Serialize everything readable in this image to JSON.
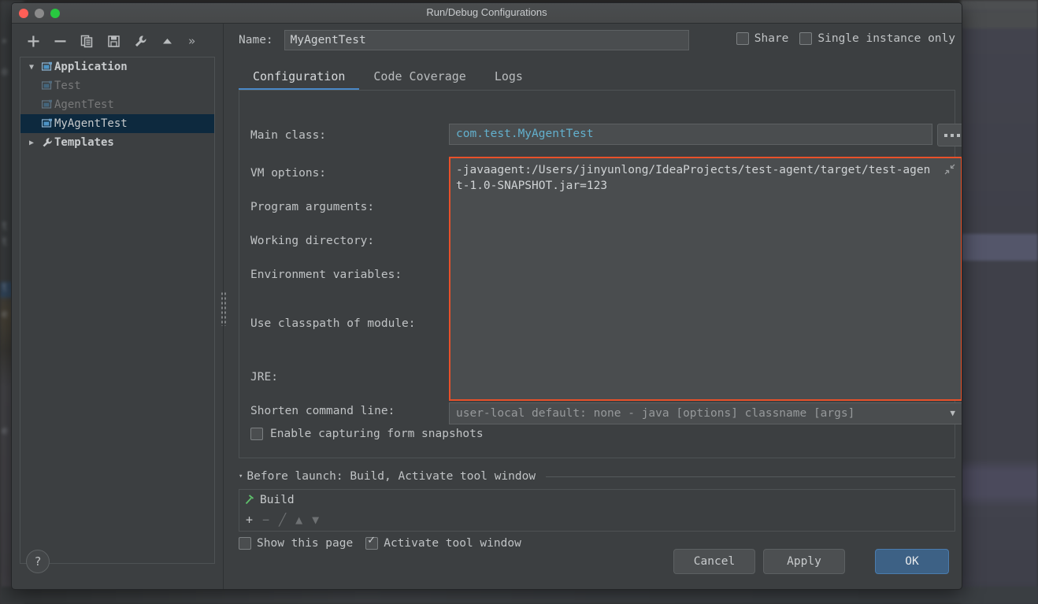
{
  "window": {
    "title": "Run/Debug Configurations",
    "traffic_lights": [
      "close",
      "minimize",
      "zoom"
    ]
  },
  "left_toolbar": {
    "buttons": [
      {
        "name": "add-configuration",
        "icon": "plus-icon"
      },
      {
        "name": "remove-configuration",
        "icon": "minus-icon"
      },
      {
        "name": "copy-configuration",
        "icon": "copy-icon"
      },
      {
        "name": "save-configuration",
        "icon": "save-icon"
      },
      {
        "name": "edit-templates",
        "icon": "wrench-icon"
      },
      {
        "name": "move-up",
        "icon": "triangle-up-icon"
      }
    ],
    "overflow_label": "»"
  },
  "tree": {
    "nodes": [
      {
        "label": "Application",
        "expander": "▼",
        "icon": "application-icon",
        "bold": true,
        "dim": false,
        "selected": false,
        "indent": 0
      },
      {
        "label": "Test",
        "expander": "",
        "icon": "application-icon",
        "bold": false,
        "dim": true,
        "selected": false,
        "indent": 1
      },
      {
        "label": "AgentTest",
        "expander": "",
        "icon": "application-icon",
        "bold": false,
        "dim": true,
        "selected": false,
        "indent": 1
      },
      {
        "label": "MyAgentTest",
        "expander": "",
        "icon": "application-icon",
        "bold": false,
        "dim": false,
        "selected": true,
        "indent": 1
      },
      {
        "label": "Templates",
        "expander": "▶",
        "icon": "wrench-icon",
        "bold": true,
        "dim": false,
        "selected": false,
        "indent": 0
      }
    ]
  },
  "header": {
    "name_label": "Name:",
    "name_value": "MyAgentTest",
    "share_label": "Share",
    "share_checked": false,
    "single_instance_label": "Single instance only",
    "single_instance_checked": false
  },
  "tabs": [
    {
      "label": "Configuration",
      "active": true
    },
    {
      "label": "Code Coverage",
      "active": false
    },
    {
      "label": "Logs",
      "active": false
    }
  ],
  "configuration": {
    "main_class_label": "Main class:",
    "main_class_value": "com.test.MyAgentTest",
    "browse_button_label": "...",
    "vm_options_label": "VM options:",
    "vm_options_value": "-javaagent:/Users/jinyunlong/IdeaProjects/test-agent/target/test-agent-1.0-SNAPSHOT.jar=123",
    "vm_options_expand_icon": "collapse-icon",
    "program_arguments_label": "Program arguments:",
    "working_directory_label": "Working directory:",
    "environment_variables_label": "Environment variables:",
    "use_classpath_label": "Use classpath of module:",
    "jre_label": "JRE:",
    "shorten_command_line_label": "Shorten command line:",
    "shorten_command_line_value": "user-local default: none - java [options] classname [args]",
    "enable_snapshots_label": "Enable capturing form snapshots",
    "enable_snapshots_checked": false
  },
  "before_launch": {
    "header": "Before launch: Build, Activate tool window",
    "collapse_arrow": "▾",
    "items": [
      {
        "label": "Build",
        "icon": "hammer-icon"
      }
    ],
    "toolbar": [
      {
        "name": "add-task",
        "glyph": "+",
        "enabled": true
      },
      {
        "name": "remove-task",
        "glyph": "−",
        "enabled": false
      },
      {
        "name": "edit-task",
        "glyph": "╱",
        "enabled": false
      },
      {
        "name": "move-task-up",
        "glyph": "▲",
        "enabled": false
      },
      {
        "name": "move-task-down",
        "glyph": "▼",
        "enabled": false
      }
    ],
    "show_page_label": "Show this page",
    "show_page_checked": false,
    "activate_tool_window_label": "Activate tool window",
    "activate_tool_window_checked": true
  },
  "footer": {
    "help_label": "?",
    "cancel_label": "Cancel",
    "apply_label": "Apply",
    "ok_label": "OK"
  },
  "colors": {
    "dialog_bg": "#3c3f41",
    "field_bg": "#4a4d4f",
    "accent_tab": "#4a88c7",
    "highlight_border": "#e8512a",
    "selection_bg": "#0d293e",
    "ok_button": "#3d6185",
    "link_text": "#63b0cd"
  }
}
